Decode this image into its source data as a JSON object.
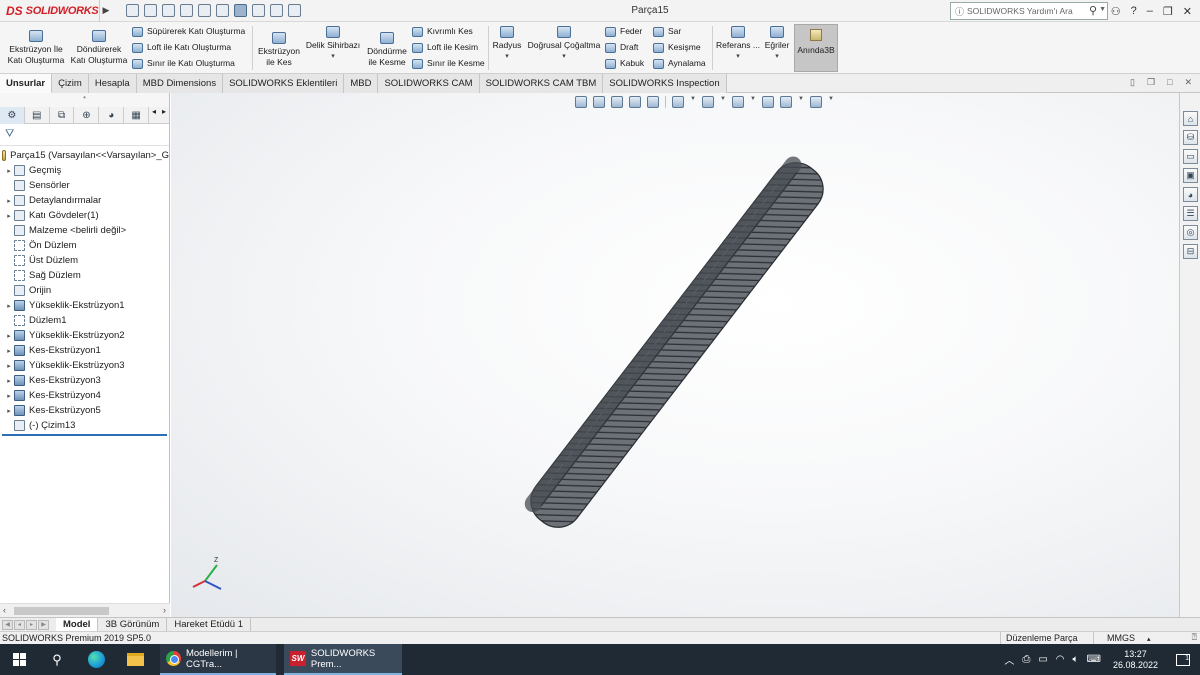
{
  "app": {
    "logo_ds": "DS",
    "logo_text": "SOLIDWORKS",
    "document_title": "Parça15",
    "help_search_placeholder": "SOLIDWORKS Yardım'ı Ara"
  },
  "ribbon": {
    "extrude_boss_line1": "Ekstrüzyon İle",
    "extrude_boss_line2": "Katı Oluşturma",
    "revolve_boss_line1": "Döndürerek",
    "revolve_boss_line2": "Katı Oluşturma",
    "swept_boss": "Süpürerek Katı Oluşturma",
    "loft_boss": "Loft ile Katı Oluşturma",
    "boundary_boss": "Sınır ile Katı Oluşturma",
    "extruded_cut_line1": "Ekstrüzyon",
    "extruded_cut_line2": "ile Kes",
    "hole_wizard": "Delik Sihirbazı",
    "revolved_cut_line1": "Döndürme",
    "revolved_cut_line2": "ile Kesme",
    "swept_cut": "Kıvrımlı Kes",
    "lofted_cut": "Loft ile Kesim",
    "boundary_cut": "Sınır ile Kesme",
    "fillet": "Radyus",
    "linear_pattern": "Doğrusal Çoğaltma",
    "rib": "Feder",
    "draft": "Draft",
    "shell": "Kabuk",
    "wrap": "Sar",
    "intersect": "Kesişme",
    "mirror": "Aynalama",
    "reference_geometry": "Referans ...",
    "curves": "Eğriler",
    "instant3d": "Anında3B",
    "dropdown_caret": "▾"
  },
  "tabs": [
    {
      "label": "Unsurlar",
      "active": true
    },
    {
      "label": "Çizim",
      "active": false
    },
    {
      "label": "Hesapla",
      "active": false
    },
    {
      "label": "MBD Dimensions",
      "active": false
    },
    {
      "label": "SOLIDWORKS Eklentileri",
      "active": false
    },
    {
      "label": "MBD",
      "active": false
    },
    {
      "label": "SOLIDWORKS CAM",
      "active": false
    },
    {
      "label": "SOLIDWORKS CAM TBM",
      "active": false
    },
    {
      "label": "SOLIDWORKS Inspection",
      "active": false
    }
  ],
  "tree": {
    "root": "Parça15  (Varsayılan<<Varsayılan>_G",
    "items": [
      {
        "label": "Geçmiş",
        "expandable": true,
        "icon": "folder-icon"
      },
      {
        "label": "Sensörler",
        "expandable": false,
        "icon": "sensor-icon"
      },
      {
        "label": "Detaylandırmalar",
        "expandable": true,
        "icon": "annotation-icon"
      },
      {
        "label": "Katı Gövdeler(1)",
        "expandable": true,
        "icon": "solid-bodies-icon"
      },
      {
        "label": "Malzeme <belirli değil>",
        "expandable": false,
        "icon": "material-icon"
      },
      {
        "label": "Ön Düzlem",
        "expandable": false,
        "icon": "plane-icon"
      },
      {
        "label": "Üst Düzlem",
        "expandable": false,
        "icon": "plane-icon"
      },
      {
        "label": "Sağ Düzlem",
        "expandable": false,
        "icon": "plane-icon"
      },
      {
        "label": "Orijin",
        "expandable": false,
        "icon": "origin-icon"
      },
      {
        "label": "Yükseklik-Ekstrüzyon1",
        "expandable": true,
        "icon": "extrude-icon"
      },
      {
        "label": "Düzlem1",
        "expandable": false,
        "icon": "plane-icon"
      },
      {
        "label": "Yükseklik-Ekstrüzyon2",
        "expandable": true,
        "icon": "extrude-icon"
      },
      {
        "label": "Kes-Ekstrüzyon1",
        "expandable": true,
        "icon": "cut-extrude-icon"
      },
      {
        "label": "Yükseklik-Ekstrüzyon3",
        "expandable": true,
        "icon": "extrude-icon"
      },
      {
        "label": "Kes-Ekstrüzyon3",
        "expandable": true,
        "icon": "cut-extrude-icon"
      },
      {
        "label": "Kes-Ekstrüzyon4",
        "expandable": true,
        "icon": "cut-extrude-icon"
      },
      {
        "label": "Kes-Ekstrüzyon5",
        "expandable": true,
        "icon": "cut-extrude-icon"
      },
      {
        "label": "(-) Çizim13",
        "expandable": false,
        "icon": "sketch-icon"
      }
    ]
  },
  "triad": {
    "z_label": "Z"
  },
  "model_tabs": [
    {
      "label": "Model",
      "active": true
    },
    {
      "label": "3B Görünüm",
      "active": false
    },
    {
      "label": "Hareket Etüdü 1",
      "active": false
    }
  ],
  "status": {
    "product": "SOLIDWORKS Premium 2019 SP5.0",
    "mode": "Düzenleme Parça",
    "units": "MMGS",
    "units_caret": "▴"
  },
  "taskbar": {
    "chrome_title": "Modellerim | CGTra...",
    "sw_title": "SOLIDWORKS Prem...",
    "sw_icon_text": "SW",
    "time": "13:27",
    "date": "26.08.2022",
    "notif_count": "1"
  }
}
